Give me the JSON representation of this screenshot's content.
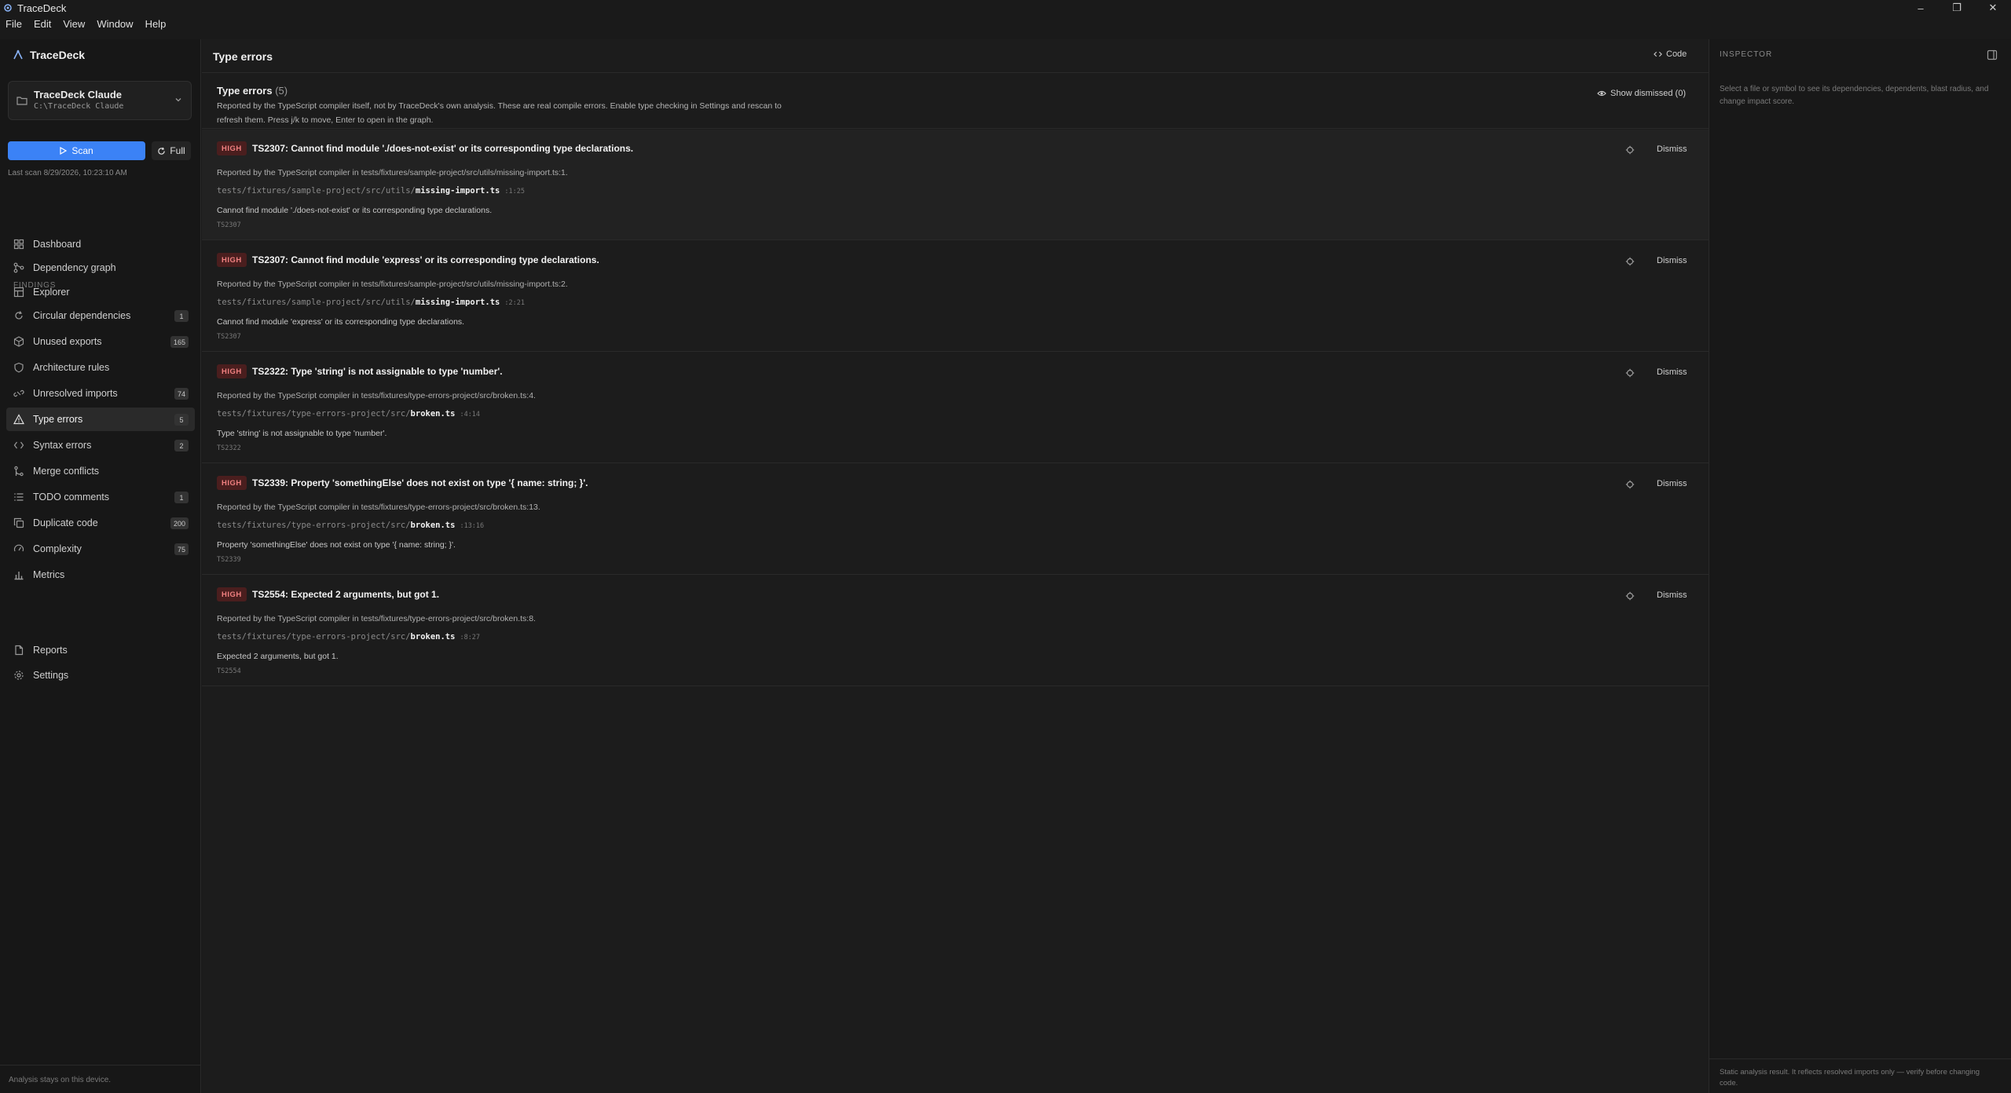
{
  "window": {
    "title": "TraceDeck"
  },
  "menu": [
    "File",
    "Edit",
    "View",
    "Window",
    "Help"
  ],
  "sidebar": {
    "brand": "TraceDeck",
    "project": {
      "name": "TraceDeck Claude",
      "path": "C:\\TraceDeck Claude"
    },
    "scan_label": "Scan",
    "full_label": "Full",
    "last_scan": "Last scan 8/29/2026, 10:23:10 AM",
    "nav_top": [
      {
        "label": "Dashboard",
        "icon": "dashboard-icon"
      },
      {
        "label": "Dependency graph",
        "icon": "graph-icon"
      },
      {
        "label": "Explorer",
        "icon": "explorer-icon"
      }
    ],
    "findings_label": "FINDINGS",
    "findings": [
      {
        "label": "Circular dependencies",
        "badge": "1",
        "icon": "cycle-icon"
      },
      {
        "label": "Unused exports",
        "badge": "165",
        "icon": "package-icon"
      },
      {
        "label": "Architecture rules",
        "badge": "",
        "icon": "shield-icon"
      },
      {
        "label": "Unresolved imports",
        "badge": "74",
        "icon": "unlink-icon"
      },
      {
        "label": "Type errors",
        "badge": "5",
        "icon": "warning-icon",
        "active": true
      },
      {
        "label": "Syntax errors",
        "badge": "2",
        "icon": "code-icon"
      },
      {
        "label": "Merge conflicts",
        "badge": "",
        "icon": "merge-icon"
      },
      {
        "label": "TODO comments",
        "badge": "1",
        "icon": "list-icon"
      },
      {
        "label": "Duplicate code",
        "badge": "200",
        "icon": "copy-icon"
      },
      {
        "label": "Complexity",
        "badge": "75",
        "icon": "gauge-icon"
      },
      {
        "label": "Metrics",
        "badge": "",
        "icon": "bar-chart-icon"
      }
    ],
    "nav_bottom": [
      {
        "label": "Reports",
        "icon": "file-icon"
      },
      {
        "label": "Settings",
        "icon": "gear-icon"
      }
    ],
    "footer": "Analysis stays on this device."
  },
  "main": {
    "header_title": "Type errors",
    "code_label": "Code",
    "intro_title": "Type errors",
    "intro_count": "(5)",
    "intro_desc": "Reported by the TypeScript compiler itself, not by TraceDeck's own analysis. These are real compile errors. Enable type checking in Settings and rescan to refresh them. Press j/k to move, Enter to open in the graph.",
    "show_dismissed": "Show dismissed (0)",
    "dismiss_label": "Dismiss",
    "items": [
      {
        "severity": "HIGH",
        "title": "TS2307: Cannot find module './does-not-exist' or its corresponding type declarations.",
        "reported": "Reported by the TypeScript compiler in tests/fixtures/sample-project/src/utils/missing-import.ts:1.",
        "dir": "tests/fixtures/sample-project/src/utils/",
        "file": "missing-import.ts",
        "loc": ":1:25",
        "message": "Cannot find module './does-not-exist' or its corresponding type declarations.",
        "code": "TS2307"
      },
      {
        "severity": "HIGH",
        "title": "TS2307: Cannot find module 'express' or its corresponding type declarations.",
        "reported": "Reported by the TypeScript compiler in tests/fixtures/sample-project/src/utils/missing-import.ts:2.",
        "dir": "tests/fixtures/sample-project/src/utils/",
        "file": "missing-import.ts",
        "loc": ":2:21",
        "message": "Cannot find module 'express' or its corresponding type declarations.",
        "code": "TS2307"
      },
      {
        "severity": "HIGH",
        "title": "TS2322: Type 'string' is not assignable to type 'number'.",
        "reported": "Reported by the TypeScript compiler in tests/fixtures/type-errors-project/src/broken.ts:4.",
        "dir": "tests/fixtures/type-errors-project/src/",
        "file": "broken.ts",
        "loc": ":4:14",
        "message": "Type 'string' is not assignable to type 'number'.",
        "code": "TS2322"
      },
      {
        "severity": "HIGH",
        "title": "TS2339: Property 'somethingElse' does not exist on type '{ name: string; }'.",
        "reported": "Reported by the TypeScript compiler in tests/fixtures/type-errors-project/src/broken.ts:13.",
        "dir": "tests/fixtures/type-errors-project/src/",
        "file": "broken.ts",
        "loc": ":13:16",
        "message": "Property 'somethingElse' does not exist on type '{ name: string; }'.",
        "code": "TS2339"
      },
      {
        "severity": "HIGH",
        "title": "TS2554: Expected 2 arguments, but got 1.",
        "reported": "Reported by the TypeScript compiler in tests/fixtures/type-errors-project/src/broken.ts:8.",
        "dir": "tests/fixtures/type-errors-project/src/",
        "file": "broken.ts",
        "loc": ":8:27",
        "message": "Expected 2 arguments, but got 1.",
        "code": "TS2554"
      }
    ]
  },
  "inspector": {
    "title": "INSPECTOR",
    "hint": "Select a file or symbol to see its dependencies, dependents, blast radius, and change impact score.",
    "footer": "Static analysis result. It reflects resolved imports only — verify before changing code."
  },
  "colors": {
    "accent": "#3b82f6",
    "high_badge_bg": "#4a1e1e",
    "high_badge_text": "#f08080"
  }
}
